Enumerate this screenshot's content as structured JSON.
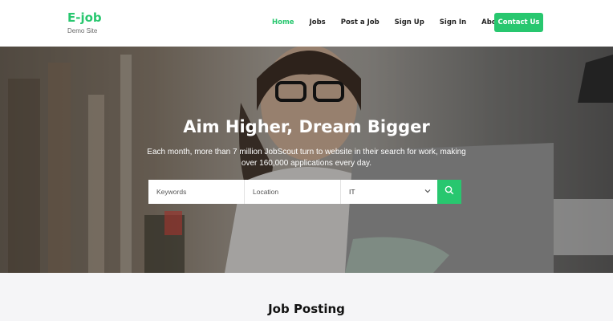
{
  "brand": {
    "name": "E-job",
    "subtitle": "Demo Site"
  },
  "nav": {
    "items": [
      "Home",
      "Jobs",
      "Post a Job",
      "Sign Up",
      "Sign In",
      "About"
    ],
    "active": "Home",
    "contact_label": "Contact Us"
  },
  "hero": {
    "title": "Aim Higher, Dream Bigger",
    "subtitle": "Each month, more than 7 million JobScout turn to website in their search for work, making over 160,000 applications every day."
  },
  "search": {
    "keywords_placeholder": "Keywords",
    "location_placeholder": "Location",
    "category_value": "IT",
    "button_icon": "search-icon"
  },
  "section": {
    "title": "Job Posting"
  },
  "colors": {
    "accent": "#28c76f",
    "section_bg": "#f5f5f7"
  }
}
